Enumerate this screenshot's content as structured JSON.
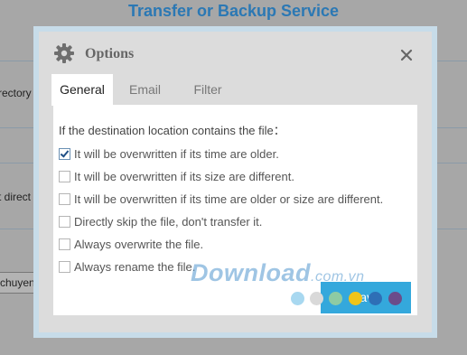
{
  "background": {
    "title": "Transfer or Backup Service",
    "labels": [
      "rectory",
      "t direct"
    ],
    "box_value": "chuyen"
  },
  "dialog": {
    "title": "Options",
    "icon": "gear-icon",
    "close_icon": "close-icon",
    "tabs": [
      {
        "label": "General",
        "active": true
      },
      {
        "label": "Email",
        "active": false
      },
      {
        "label": "Filter",
        "active": false
      }
    ],
    "intro": "If the destination location contains the file：",
    "options": [
      {
        "label": "It will be overwritten if its time are older.",
        "checked": true
      },
      {
        "label": "It will be overwritten if its size are different.",
        "checked": false
      },
      {
        "label": "It will be overwritten if its time are older or size are different.",
        "checked": false
      },
      {
        "label": "Directly skip the file, don't transfer it.",
        "checked": false
      },
      {
        "label": "Always overwrite the file.",
        "checked": false
      },
      {
        "label": "Always rename the file.",
        "checked": false
      }
    ],
    "save_label": "Save"
  },
  "watermark": {
    "main": "Download",
    "suffix": ".com.vn"
  },
  "colors": {
    "title_blue": "#2b78b4",
    "save_button": "#34a8dc",
    "dialog_frame": "#c7dce9",
    "watermark_dots": [
      "#a8d8f0",
      "#d9d9d9",
      "#8ecba3",
      "#f0c419",
      "#2e6fb6",
      "#6b4c8a"
    ]
  }
}
